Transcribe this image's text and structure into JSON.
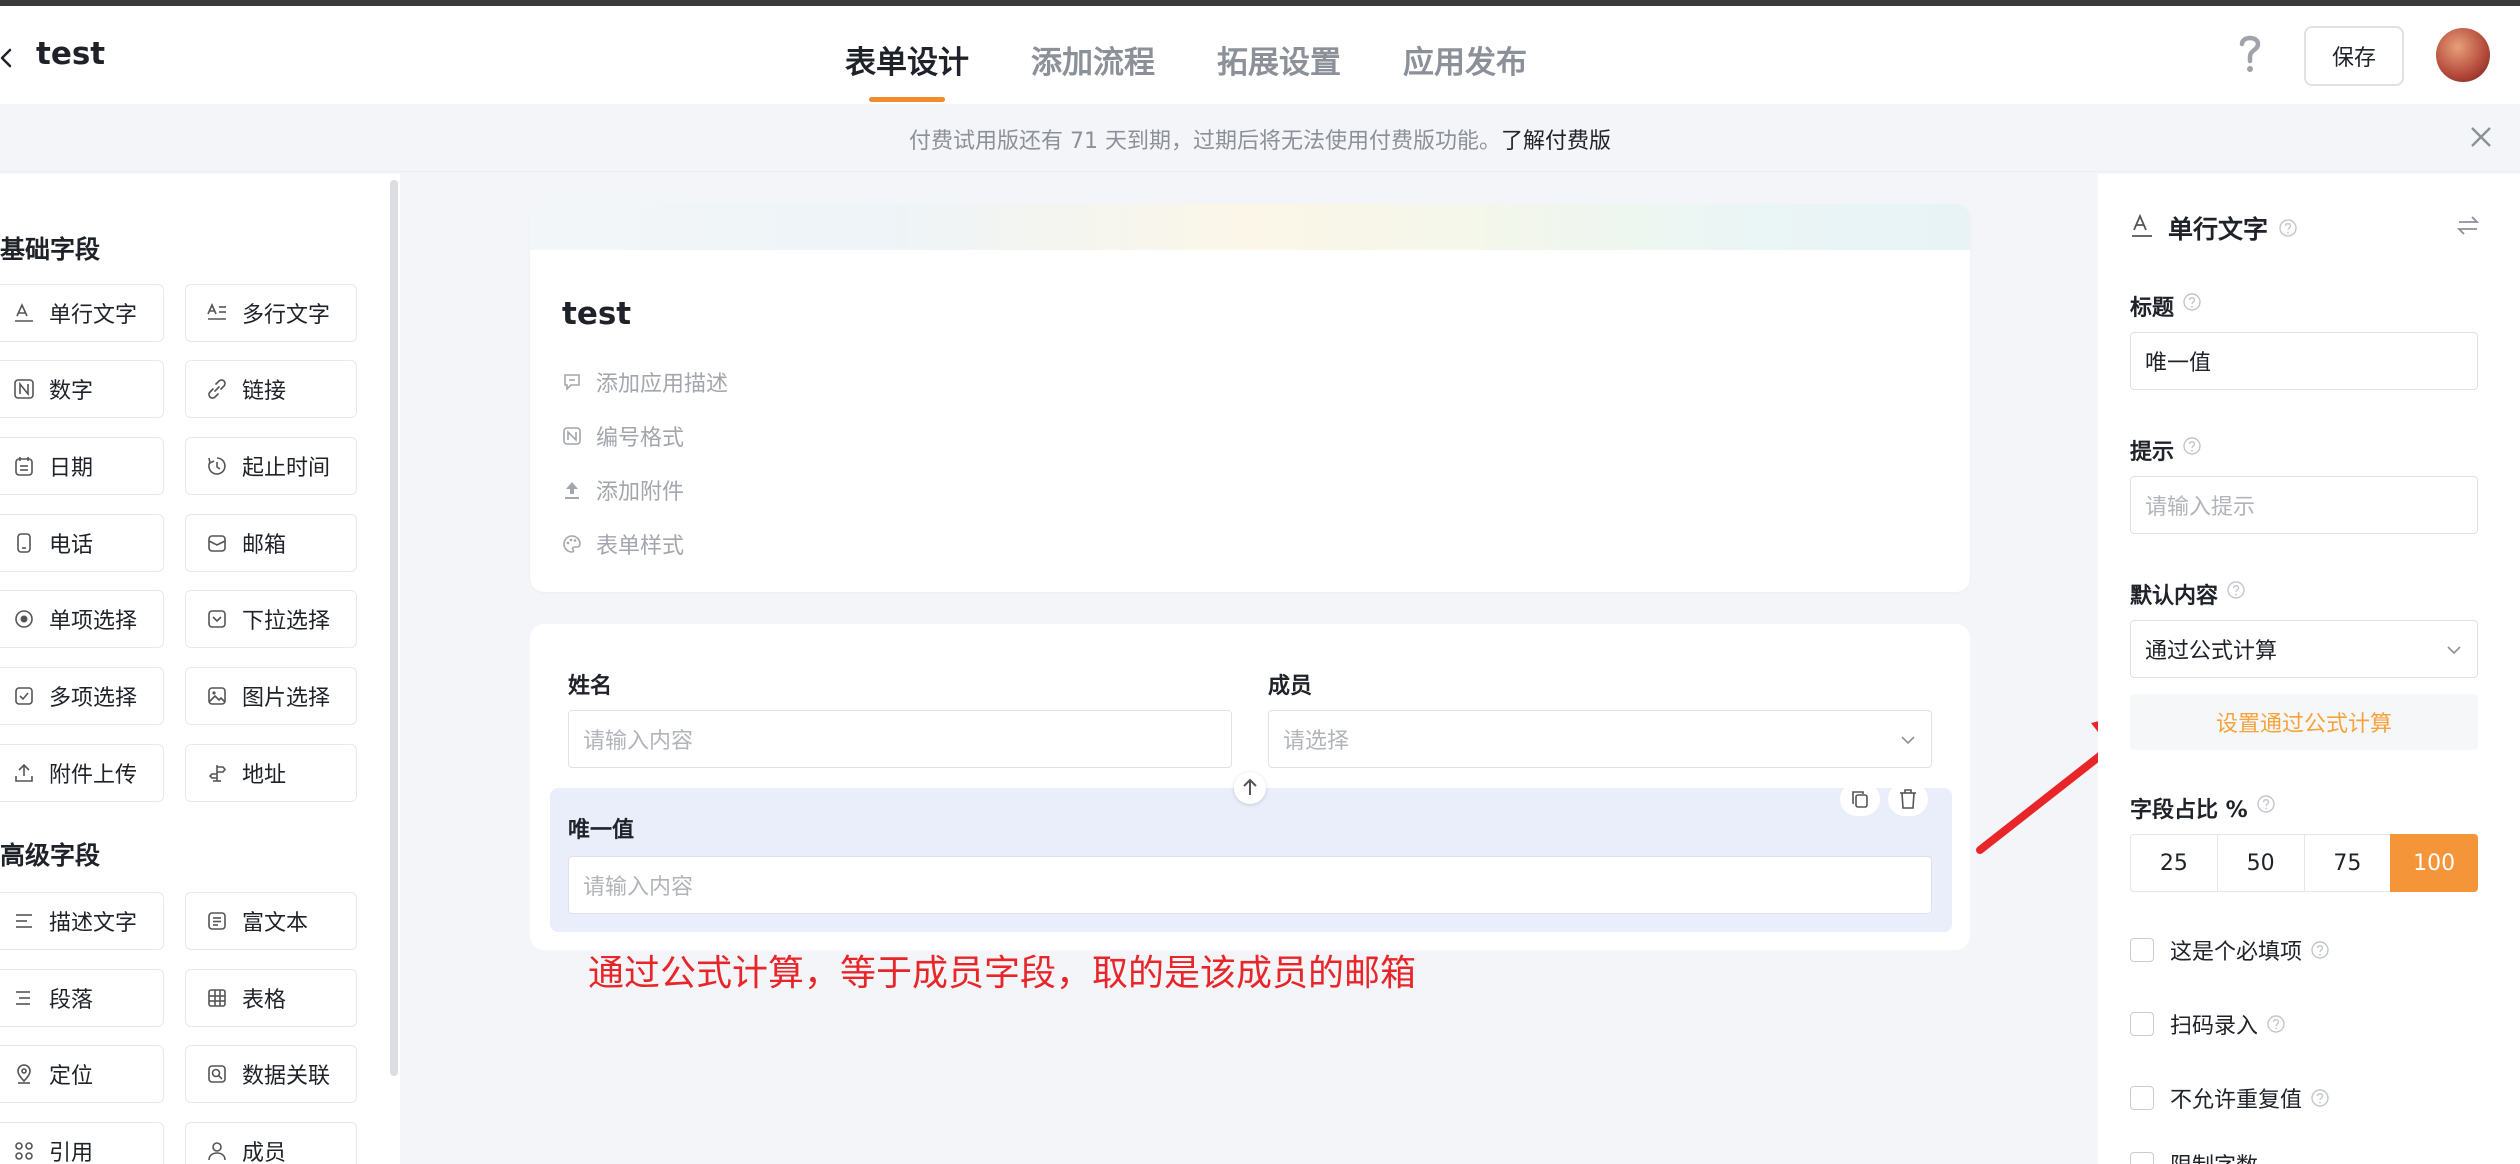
{
  "header": {
    "app_title": "test",
    "tabs": [
      {
        "label": "表单设计",
        "active": true
      },
      {
        "label": "添加流程",
        "active": false
      },
      {
        "label": "拓展设置",
        "active": false
      },
      {
        "label": "应用发布",
        "active": false
      }
    ],
    "save_label": "保存"
  },
  "banner": {
    "text": "付费试用版还有 71 天到期，过期后将无法使用付费版功能。",
    "link": "了解付费版"
  },
  "left": {
    "basic_title": "基础字段",
    "advanced_title": "高级字段",
    "basic_fields": [
      {
        "label": "单行文字",
        "icon": "text-icon"
      },
      {
        "label": "多行文字",
        "icon": "multiline-text-icon"
      },
      {
        "label": "数字",
        "icon": "number-icon"
      },
      {
        "label": "链接",
        "icon": "link-icon"
      },
      {
        "label": "日期",
        "icon": "calendar-icon"
      },
      {
        "label": "起止时间",
        "icon": "time-range-icon"
      },
      {
        "label": "电话",
        "icon": "phone-icon"
      },
      {
        "label": "邮箱",
        "icon": "mail-icon"
      },
      {
        "label": "单项选择",
        "icon": "radio-icon"
      },
      {
        "label": "下拉选择",
        "icon": "dropdown-icon"
      },
      {
        "label": "多项选择",
        "icon": "checkbox-icon"
      },
      {
        "label": "图片选择",
        "icon": "image-icon"
      },
      {
        "label": "附件上传",
        "icon": "upload-icon"
      },
      {
        "label": "地址",
        "icon": "address-icon"
      }
    ],
    "advanced_fields": [
      {
        "label": "描述文字",
        "icon": "description-icon"
      },
      {
        "label": "富文本",
        "icon": "rich-text-icon"
      },
      {
        "label": "段落",
        "icon": "paragraph-icon"
      },
      {
        "label": "表格",
        "icon": "table-icon"
      },
      {
        "label": "定位",
        "icon": "location-icon"
      },
      {
        "label": "数据关联",
        "icon": "data-link-icon"
      },
      {
        "label": "引用",
        "icon": "reference-icon"
      },
      {
        "label": "成员",
        "icon": "member-icon"
      }
    ]
  },
  "form": {
    "title": "test",
    "meta": [
      {
        "label": "添加应用描述",
        "icon": "comment-icon"
      },
      {
        "label": "编号格式",
        "icon": "number-format-icon"
      },
      {
        "label": "添加附件",
        "icon": "upload-icon"
      },
      {
        "label": "表单样式",
        "icon": "palette-icon"
      }
    ],
    "fields": {
      "name": {
        "label": "姓名",
        "placeholder": "请输入内容"
      },
      "member": {
        "label": "成员",
        "placeholder": "请选择"
      },
      "unique": {
        "label": "唯一值",
        "placeholder": "请输入内容"
      }
    },
    "annotation": "通过公式计算，等于成员字段，取的是该成员的邮箱"
  },
  "props": {
    "type_label": "单行文字",
    "title_label": "标题",
    "title_value": "唯一值",
    "hint_label": "提示",
    "hint_placeholder": "请输入提示",
    "default_label": "默认内容",
    "default_value": "通过公式计算",
    "formula_button": "设置通过公式计算",
    "ratio_label": "字段占比 %",
    "ratio_options": [
      "25",
      "50",
      "75",
      "100"
    ],
    "ratio_selected": "100",
    "checks": [
      "这是个必填项",
      "扫码录入",
      "不允许重复值",
      "限制字数"
    ]
  }
}
